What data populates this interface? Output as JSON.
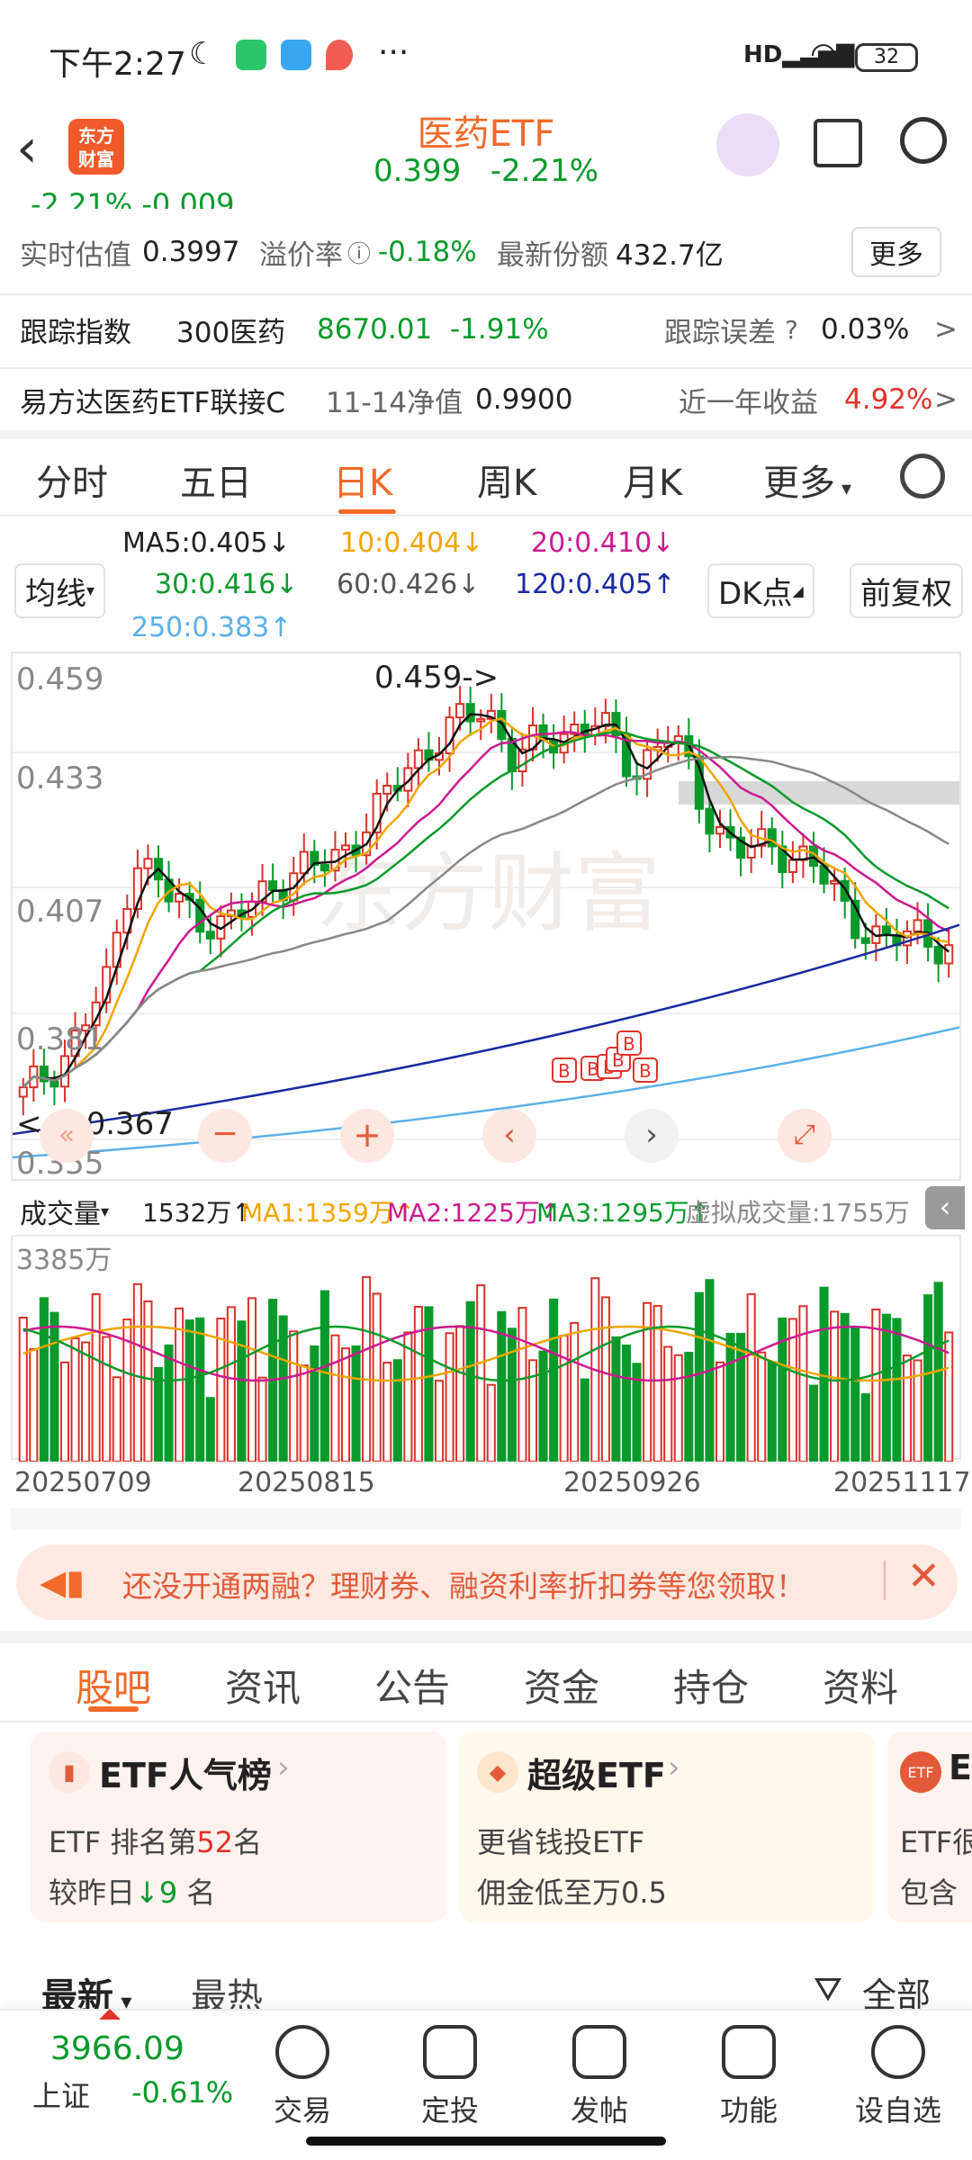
{
  "status": {
    "time": "下午2:27",
    "battery": "32"
  },
  "header": {
    "logo_text_top": "东方",
    "logo_text_bottom": "财富",
    "title": "医药ETF",
    "price": "0.399",
    "change": "-2.21%"
  },
  "info": {
    "partial_top": "-2.21%   -0.009",
    "row1": {
      "label1": "实时估值",
      "value1": "0.3997",
      "label2": "溢价率",
      "value2": "-0.18%",
      "label3": "最新份额",
      "value3": "432.7亿",
      "more": "更多"
    },
    "row2": {
      "label1": "跟踪指数",
      "index_name": "300医药",
      "index_value": "8670.01",
      "index_change": "-1.91%",
      "label2": "跟踪误差",
      "error_value": "0.03%"
    },
    "row3": {
      "fund_name": "易方达医药ETF联接C",
      "nav_label": "11-14净值",
      "nav_value": "0.9900",
      "return_label": "近一年收益",
      "return_value": "4.92%"
    }
  },
  "kline_tabs": [
    "分时",
    "五日",
    "日K",
    "周K",
    "月K",
    "更多"
  ],
  "kline_active": "日K",
  "ma": {
    "ma_button": "均线",
    "ma5": "MA5:0.405↓",
    "ma10": "10:0.404↓",
    "ma20": "20:0.410↓",
    "ma30": "30:0.416↓",
    "ma60": "60:0.426↓",
    "ma120": "120:0.405↑",
    "ma250": "250:0.383↑",
    "dk_button": "DK点",
    "adjust_button": "前复权"
  },
  "chart_labels": {
    "y1": "0.459",
    "y2": "0.433",
    "y3": "0.407",
    "y4": "0.381",
    "y5": "0.355",
    "high_marker": "0.459->",
    "low_marker": "<----0.367",
    "watermark": "东方财富",
    "b_marker": "B"
  },
  "volume": {
    "selector": "成交量",
    "current": "1532万↑",
    "ma1": "MA1:1359万↑",
    "ma2": "MA2:1225万↑",
    "ma3": "MA3:1295万↑",
    "virtual": "虚拟成交量:1755万",
    "max_label": "3385万"
  },
  "dates": [
    "20250709",
    "20250815",
    "20250926",
    "20251117"
  ],
  "banner": {
    "text": "还没开通两融？理财券、融资利率折扣券等您领取！"
  },
  "tabs2": [
    "股吧",
    "资讯",
    "公告",
    "资金",
    "持仓",
    "资料"
  ],
  "tabs2_active": "股吧",
  "cards": [
    {
      "title": "ETF人气榜",
      "line1_prefix": "ETF 排名第",
      "line1_value": "52",
      "line1_suffix": "名",
      "line2_prefix": "较昨日",
      "line2_value": "9",
      "line2_suffix": " 名"
    },
    {
      "title": "超级ETF",
      "line1": "更省钱投ETF",
      "line2": "佣金低至万0.5"
    },
    {
      "title": "E",
      "line1": "ETF很",
      "line2": "包含"
    }
  ],
  "feed_tabs": {
    "latest": "最新",
    "hot": "最热",
    "filter": "全部"
  },
  "bottom": {
    "index_value": "3966.09",
    "index_name": "上证",
    "index_change": "-0.61%",
    "items": [
      "交易",
      "定投",
      "发帖",
      "功能",
      "设自选"
    ]
  },
  "colors": {
    "red": "#e0322b",
    "green": "#0a9a2c",
    "accent": "#f06a2a"
  },
  "chart_data": {
    "type": "candlestick",
    "ylim": [
      0.355,
      0.459
    ],
    "x_start": "20250709",
    "x_end": "20251117",
    "high": 0.459,
    "low": 0.367
  }
}
